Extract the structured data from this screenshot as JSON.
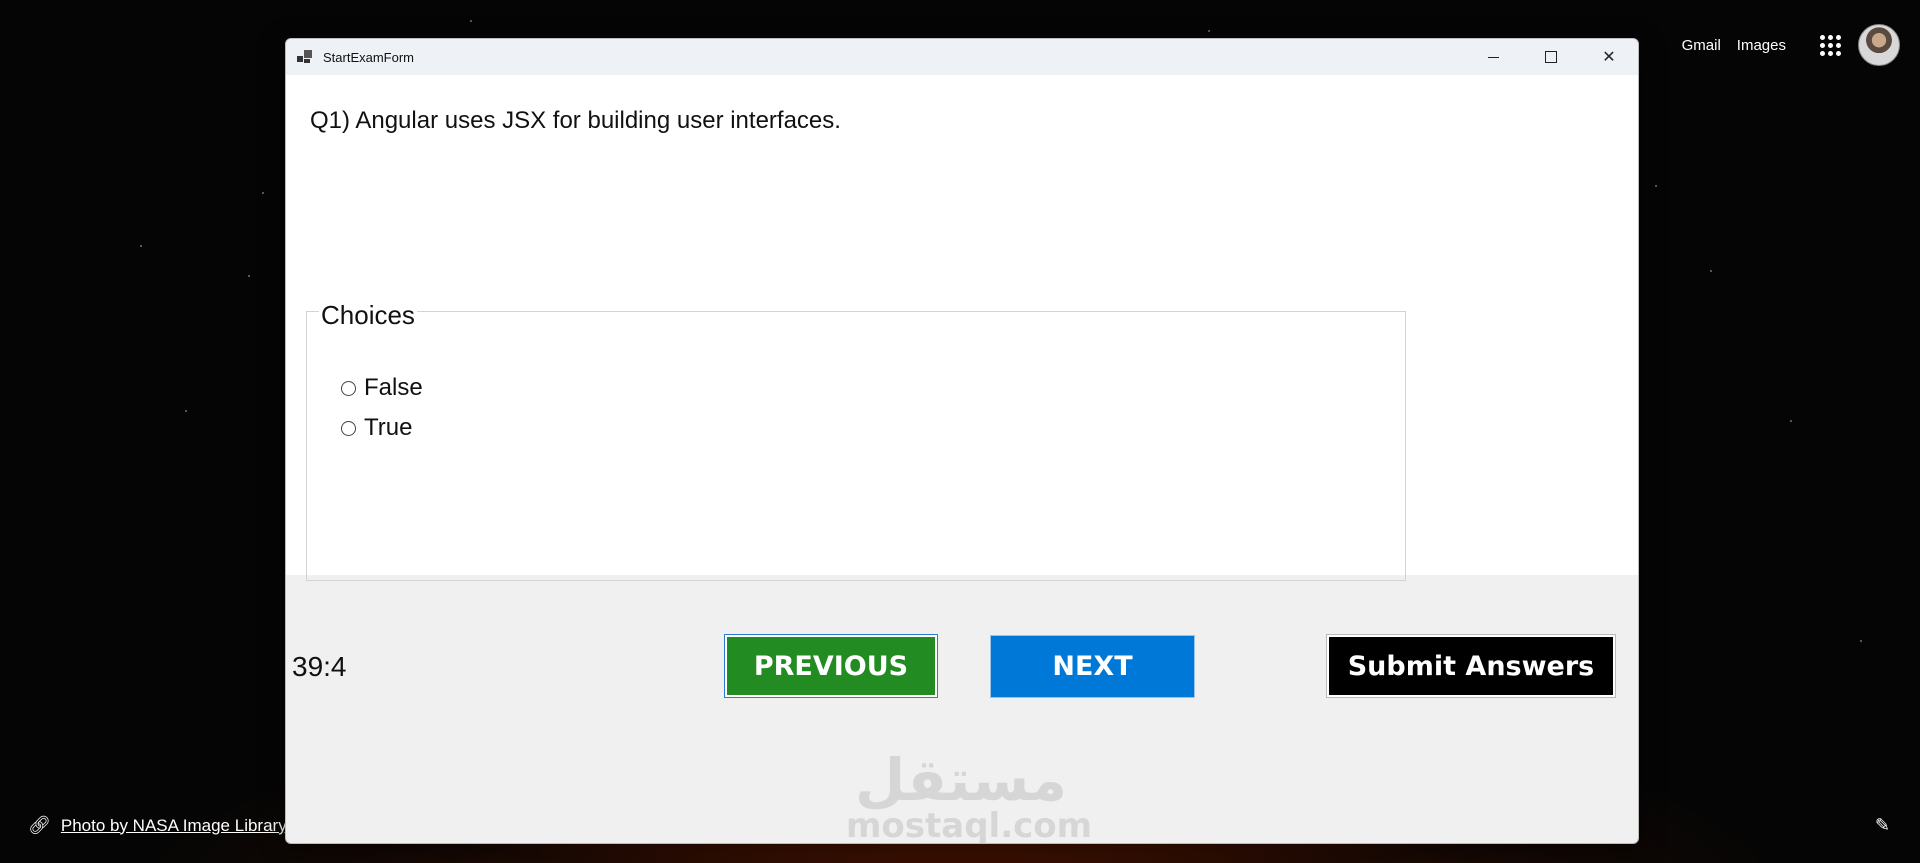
{
  "google_bar": {
    "gmail_label": "Gmail",
    "images_label": "Images",
    "apps_icon": "apps-grid-icon",
    "avatar_icon": "profile-avatar"
  },
  "background": {
    "credit_text": "Photo by NASA Image Library",
    "credit_icon": "link-icon",
    "edit_icon": "pencil-icon"
  },
  "window": {
    "title": "StartExamForm",
    "controls": {
      "minimize_icon": "minimize-icon",
      "maximize_icon": "maximize-icon",
      "close_icon": "close-icon",
      "close_glyph": "✕"
    },
    "question": "Q1) Angular uses JSX for building user interfaces.",
    "choices_group": {
      "title": "Choices",
      "options": [
        {
          "label": "False",
          "checked": false
        },
        {
          "label": "True",
          "checked": false
        }
      ]
    },
    "timer": "39:4",
    "buttons": {
      "previous": "PREVIOUS",
      "next": "NEXT",
      "submit": "Submit Answers"
    },
    "colors": {
      "previous_bg": "#228b22",
      "next_bg": "#0078d7",
      "submit_bg": "#000000"
    },
    "watermark": {
      "arabic": "مستقل",
      "latin": "mostaql.com"
    }
  }
}
